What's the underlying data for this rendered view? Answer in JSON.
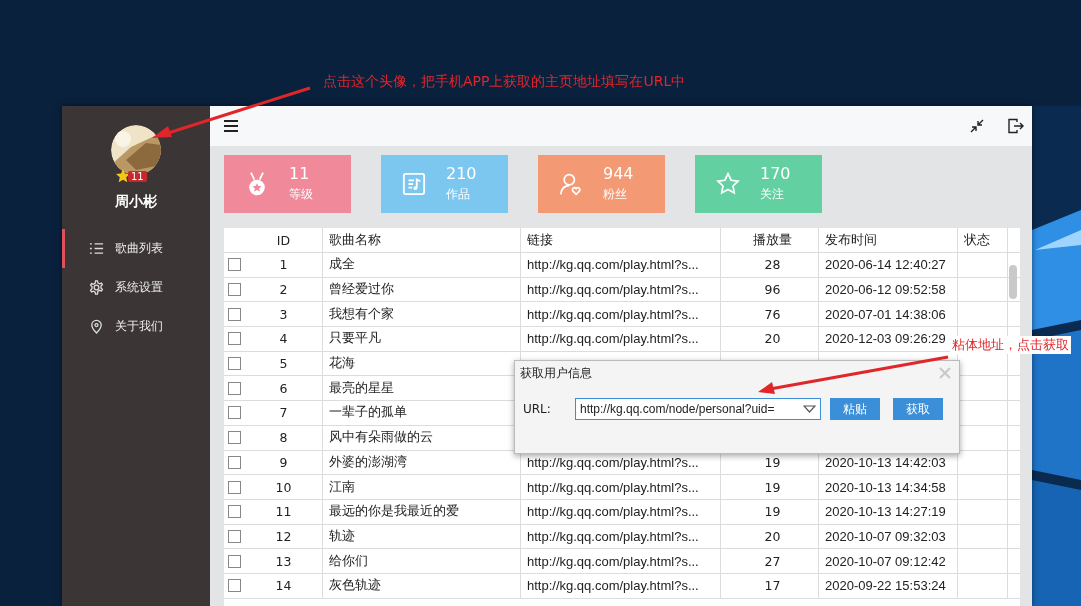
{
  "annotations": [
    {
      "text": "点击这个头像，把手机APP上获取的主页地址填写在URL中"
    },
    {
      "text": "粘体地址，点击获取"
    }
  ],
  "sidebar": {
    "user": {
      "name": "周小彬",
      "level": "11"
    },
    "items": [
      {
        "label": "歌曲列表",
        "selected": true
      },
      {
        "label": "系统设置",
        "selected": false
      },
      {
        "label": "关于我们",
        "selected": false
      }
    ]
  },
  "stats": [
    {
      "value": "11",
      "label": "等级",
      "color": "#f08a9b"
    },
    {
      "value": "210",
      "label": "作品",
      "color": "#7cc7ef"
    },
    {
      "value": "944",
      "label": "粉丝",
      "color": "#f39a74"
    },
    {
      "value": "170",
      "label": "关注",
      "color": "#62d0a0"
    }
  ],
  "table": {
    "columns": [
      "ID",
      "歌曲名称",
      "链接",
      "播放量",
      "发布时间",
      "状态"
    ],
    "rows": [
      {
        "checked": false,
        "id": "1",
        "name": "成全",
        "link": "http://kg.qq.com/play.html?s...",
        "plays": "28",
        "time": "2020-06-14 12:40:27"
      },
      {
        "checked": false,
        "id": "2",
        "name": "曾经爱过你",
        "link": "http://kg.qq.com/play.html?s...",
        "plays": "96",
        "time": "2020-06-12 09:52:58"
      },
      {
        "checked": false,
        "id": "3",
        "name": "我想有个家",
        "link": "http://kg.qq.com/play.html?s...",
        "plays": "76",
        "time": "2020-07-01 14:38:06"
      },
      {
        "checked": false,
        "id": "4",
        "name": "只要平凡",
        "link": "http://kg.qq.com/play.html?s...",
        "plays": "20",
        "time": "2020-12-03 09:26:29"
      },
      {
        "checked": false,
        "id": "5",
        "name": "花海"
      },
      {
        "checked": false,
        "id": "6",
        "name": "最亮的星星"
      },
      {
        "checked": false,
        "id": "7",
        "name": "一辈子的孤单"
      },
      {
        "checked": false,
        "id": "8",
        "name": "风中有朵雨做的云"
      },
      {
        "checked": false,
        "id": "9",
        "name": "外婆的澎湖湾",
        "link": "http://kg.qq.com/play.html?s...",
        "plays": "19",
        "time": "2020-10-13 14:42:03"
      },
      {
        "checked": false,
        "id": "10",
        "name": "江南",
        "link": "http://kg.qq.com/play.html?s...",
        "plays": "19",
        "time": "2020-10-13 14:34:58"
      },
      {
        "checked": false,
        "id": "11",
        "name": "最远的你是我最近的爱",
        "link": "http://kg.qq.com/play.html?s...",
        "plays": "19",
        "time": "2020-10-13 14:27:19"
      },
      {
        "checked": false,
        "id": "12",
        "name": "轨迹",
        "link": "http://kg.qq.com/play.html?s...",
        "plays": "20",
        "time": "2020-10-07 09:32:03"
      },
      {
        "checked": false,
        "id": "13",
        "name": "给你们",
        "link": "http://kg.qq.com/play.html?s...",
        "plays": "27",
        "time": "2020-10-07 09:12:42"
      },
      {
        "checked": false,
        "id": "14",
        "name": "灰色轨迹",
        "link": "http://kg.qq.com/play.html?s...",
        "plays": "17",
        "time": "2020-09-22 15:53:24"
      }
    ]
  },
  "dialog": {
    "title": "获取用户信息",
    "url_label": "URL:",
    "url_value": "http://kg.qq.com/node/personal?uid=",
    "buttons": [
      "粘贴",
      "获取"
    ]
  }
}
